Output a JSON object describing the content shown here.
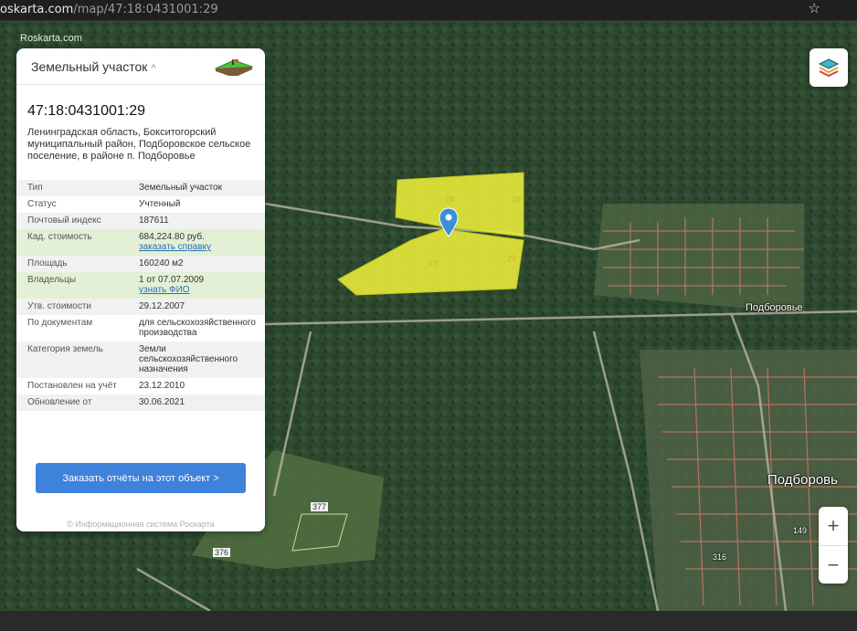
{
  "browser": {
    "url_domain": "oskarta.com",
    "url_path": "/map/47:18:0431001:29"
  },
  "map": {
    "site_label": "Roskarta.com",
    "places": [
      {
        "name": "Подборовье",
        "label": "Подборовье"
      },
      {
        "name": "Подборовье-big",
        "label": "Подборовь"
      }
    ],
    "road_numbers": [
      "377",
      "376",
      "149",
      "316"
    ],
    "parcel_numbers": [
      "29",
      "29",
      "29",
      "29"
    ]
  },
  "panel": {
    "title": "Земельный участок",
    "cad_number": "47:18:0431001:29",
    "address": "Ленинградская область, Бокситогорский муниципальный район, Подборовское сельское поселение, в районе п. Подборовье",
    "props": [
      {
        "key": "Тип",
        "value": "Земельный участок"
      },
      {
        "key": "Статус",
        "value": "Учтенный"
      },
      {
        "key": "Почтовый индекс",
        "value": "187611"
      },
      {
        "key": "Кад. стоимость",
        "value": "684,224.80 руб.",
        "link": "заказать справку"
      },
      {
        "key": "Площадь",
        "value": "160240 м2"
      },
      {
        "key": "Владельцы",
        "value": "1 от 07.07.2009",
        "link": "узнать ФИО"
      },
      {
        "key": "Утв. стоимости",
        "value": "29.12.2007"
      },
      {
        "key": "По документам",
        "value": "для сельскохозяйственного производства"
      },
      {
        "key": "Категория земель",
        "value": "Земли сельскохозяйственного назначения"
      },
      {
        "key": "Постановлен на учёт",
        "value": "23.12.2010"
      },
      {
        "key": "Обновление от",
        "value": "30.06.2021"
      }
    ],
    "order_button": "Заказать отчёты на этот объект >",
    "footer": "© Информационная система Роскарта"
  },
  "controls": {
    "zoom_in": "+",
    "zoom_out": "−"
  },
  "colors": {
    "parcel": "#e8ea3a",
    "accent": "#3e82dc",
    "marker": "#3b8fd8"
  }
}
